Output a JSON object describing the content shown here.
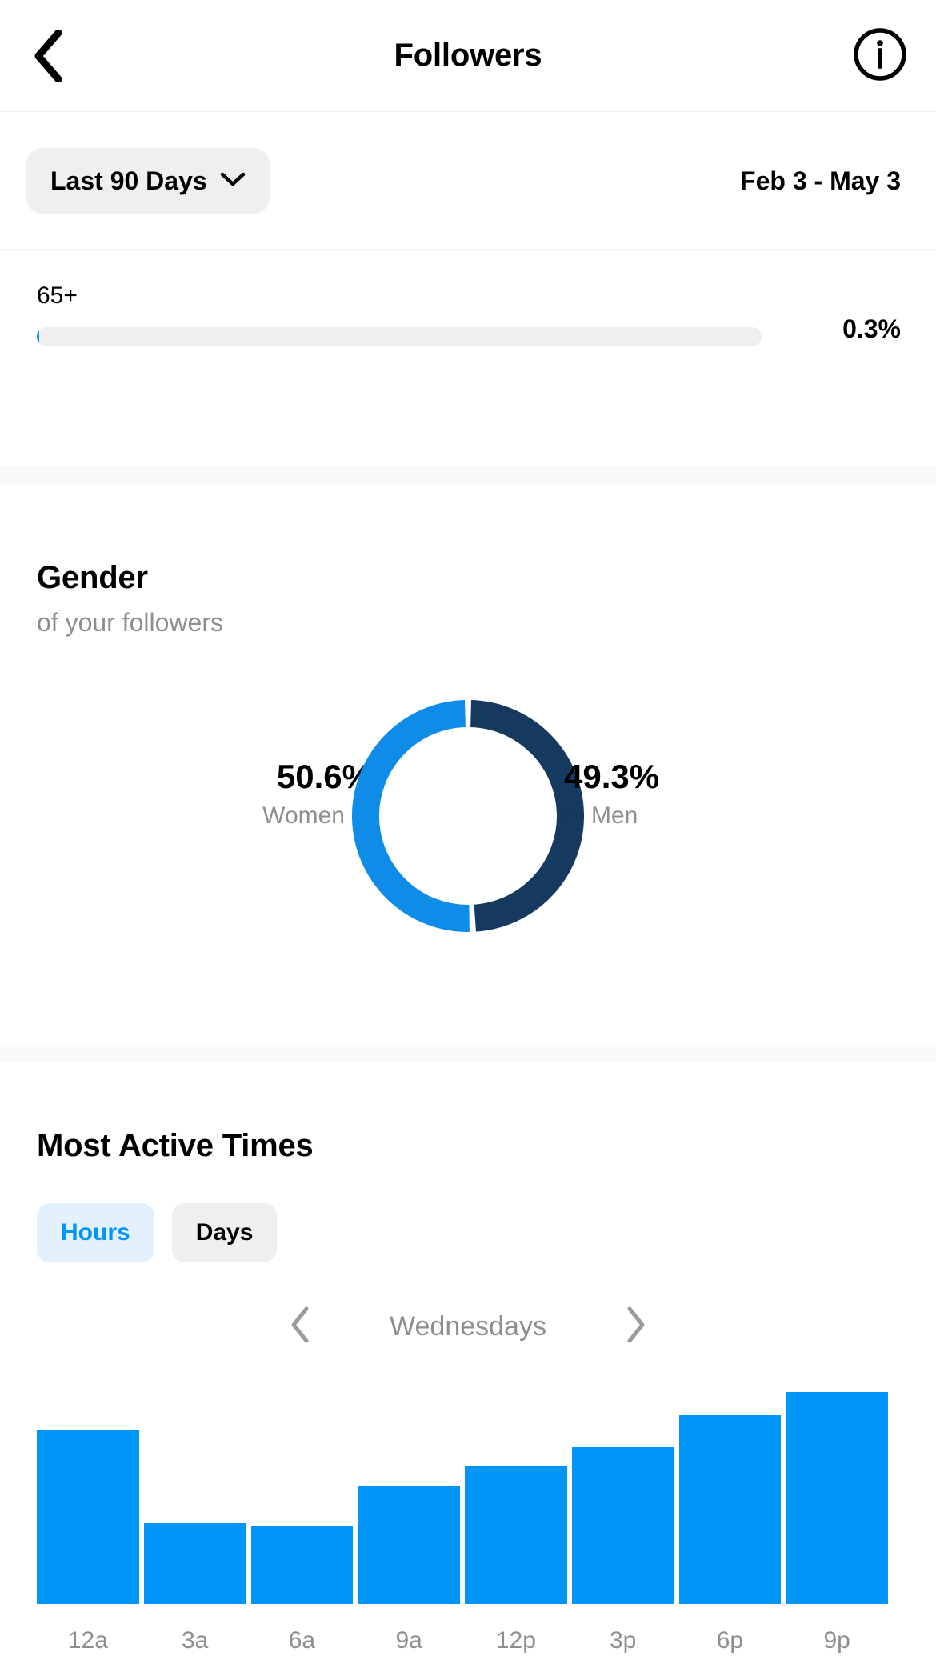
{
  "navbar": {
    "back_icon": "chevron-left-icon",
    "title": "Followers",
    "info_icon": "info-circle-icon"
  },
  "filter": {
    "range_label": "Last 90 Days",
    "chevron_icon": "chevron-down-icon",
    "date_range": "Feb 3 - May 3"
  },
  "age_section": {
    "rows": [
      {
        "label": "65+",
        "percent_label": "0.3%",
        "percent_value": 0.3
      }
    ],
    "track_color": "#efefef",
    "fill_color": "#0095f6"
  },
  "gender": {
    "title": "Gender",
    "subtitle": "of your followers",
    "women": {
      "pct_label": "50.6%",
      "name": "Women",
      "color": "#0f8ce8"
    },
    "men": {
      "pct_label": "49.3%",
      "name": "Men",
      "color": "#16395f"
    }
  },
  "most_active": {
    "title": "Most Active Times",
    "tabs": [
      {
        "label": "Hours",
        "active": true
      },
      {
        "label": "Days",
        "active": false
      }
    ],
    "prev_icon": "chevron-left-icon",
    "next_icon": "chevron-right-icon",
    "day_label": "Wednesdays"
  },
  "chart_data": {
    "type": "bar",
    "title": "Most Active Times",
    "subtitle": "Wednesdays",
    "xlabel": "",
    "ylabel": "",
    "grid": false,
    "legend": "none",
    "bar_color": "#0095f6",
    "categories": [
      "12a",
      "3a",
      "6a",
      "9a",
      "12p",
      "3p",
      "6p",
      "9p"
    ],
    "values": [
      82,
      38,
      37,
      56,
      65,
      74,
      89,
      100
    ],
    "ylim": [
      0,
      100
    ]
  },
  "colors": {
    "accent": "#0095f6",
    "women": "#0f8ce8",
    "men": "#16395f",
    "tab_active_bg": "#e3f1fd",
    "tab_inactive_bg": "#efefef",
    "muted_text": "#8e8e8e",
    "band": "#f8f9f9"
  }
}
